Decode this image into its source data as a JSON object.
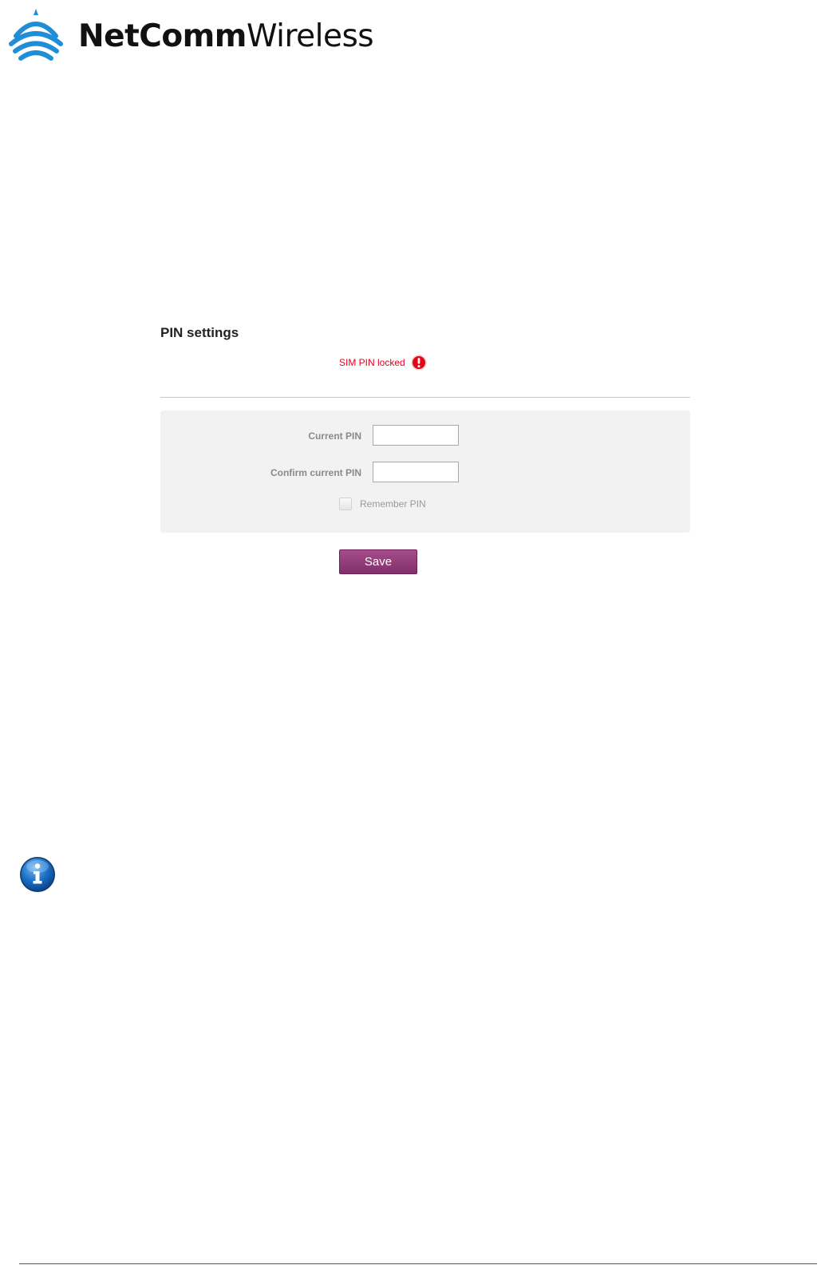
{
  "brand": {
    "name_bold": "NetComm",
    "name_light": "Wireless",
    "logo_color": "#1f8ed6"
  },
  "pin_settings": {
    "title": "PIN settings",
    "status_text": "SIM PIN locked",
    "status_color": "#e8001c",
    "current_pin_label": "Current PIN",
    "current_pin_value": "",
    "confirm_pin_label": "Confirm current PIN",
    "confirm_pin_value": "",
    "remember_label": "Remember PIN",
    "remember_checked": false,
    "save_label": "Save",
    "save_color": "#8e3a77"
  },
  "icons": {
    "logo": "wifi-waves-icon",
    "status": "exclamation-icon",
    "info": "info-icon"
  }
}
